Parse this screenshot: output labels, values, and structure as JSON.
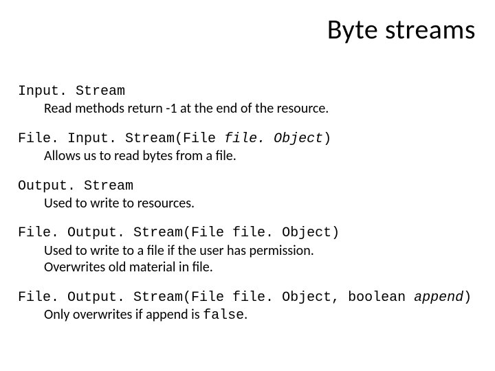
{
  "title": "Byte streams",
  "entries": [
    {
      "head_parts": [
        {
          "text": "Input. Stream",
          "mono": true,
          "italic": false
        }
      ],
      "desc_lines": [
        [
          {
            "text": "Read methods return -1 at the end of the resource.",
            "mono": false,
            "italic": false
          }
        ]
      ]
    },
    {
      "head_parts": [
        {
          "text": "File. Input. Stream(File ",
          "mono": true,
          "italic": false
        },
        {
          "text": "file. Object",
          "mono": true,
          "italic": true
        },
        {
          "text": ")",
          "mono": true,
          "italic": false
        }
      ],
      "desc_lines": [
        [
          {
            "text": "Allows us to read bytes from a file.",
            "mono": false,
            "italic": false
          }
        ]
      ]
    },
    {
      "head_parts": [
        {
          "text": "Output. Stream",
          "mono": true,
          "italic": false
        }
      ],
      "desc_lines": [
        [
          {
            "text": "Used to write to resources.",
            "mono": false,
            "italic": false
          }
        ]
      ]
    },
    {
      "head_parts": [
        {
          "text": "File. Output. Stream(File file. Object)",
          "mono": true,
          "italic": false
        }
      ],
      "desc_lines": [
        [
          {
            "text": "Used to write to a file if the user has permission.",
            "mono": false,
            "italic": false
          }
        ],
        [
          {
            "text": "Overwrites old material in file.",
            "mono": false,
            "italic": false
          }
        ]
      ]
    },
    {
      "head_parts": [
        {
          "text": "File. Output. Stream(File file. Object, boolean ",
          "mono": true,
          "italic": false
        },
        {
          "text": "append",
          "mono": true,
          "italic": true
        },
        {
          "text": ")",
          "mono": true,
          "italic": false
        }
      ],
      "desc_lines": [
        [
          {
            "text": "Only overwrites if append is ",
            "mono": false,
            "italic": false
          },
          {
            "text": "false",
            "mono": true,
            "italic": false
          },
          {
            "text": ".",
            "mono": false,
            "italic": false
          }
        ]
      ]
    }
  ]
}
